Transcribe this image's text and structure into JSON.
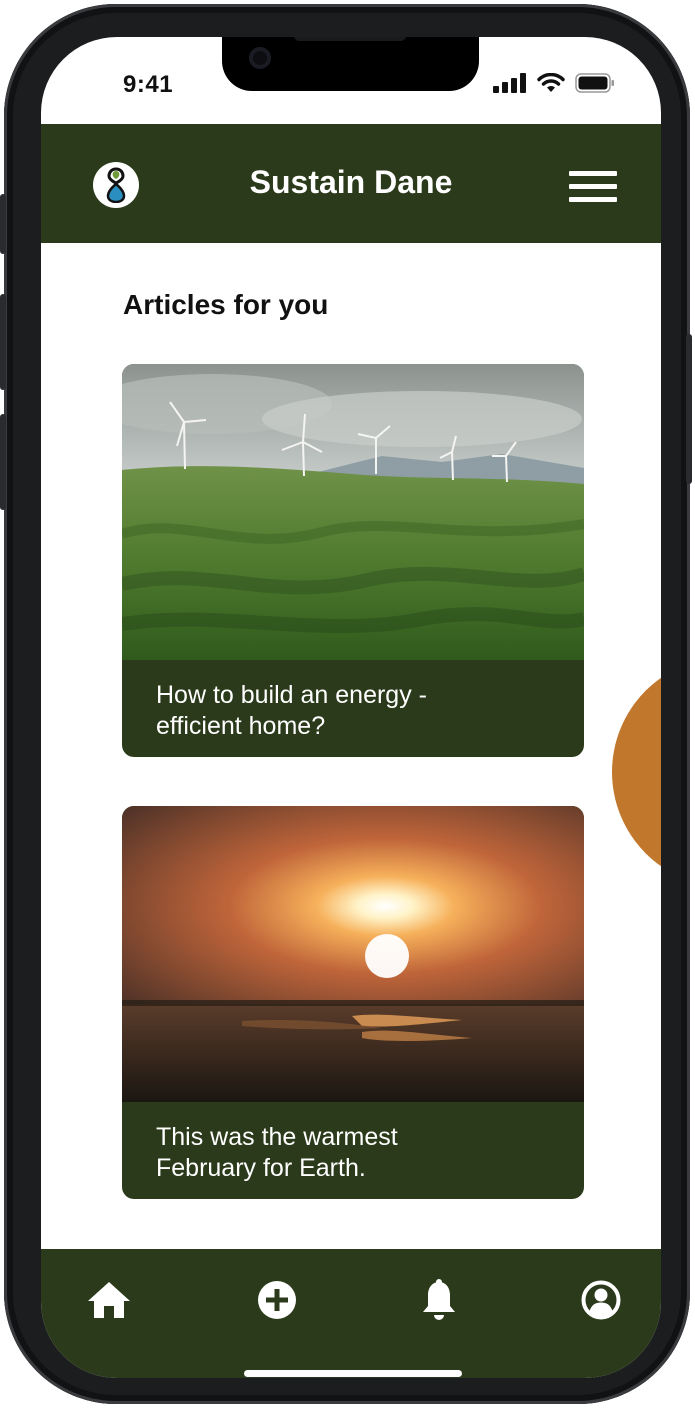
{
  "status_bar": {
    "time": "9:41"
  },
  "header": {
    "app_title": "Sustain Dane"
  },
  "section": {
    "title": "Articles for you"
  },
  "articles": [
    {
      "caption_line1": "How to build an energy -",
      "caption_line2": "efficient home?"
    },
    {
      "caption_line1": "This was the warmest",
      "caption_line2": "February for Earth."
    }
  ],
  "bottom_nav": {
    "items": [
      "home-icon",
      "add-circle-icon",
      "bell-icon",
      "account-circle-icon"
    ]
  },
  "colors": {
    "header_bg": "#2b3a1a",
    "accent_orange": "#c1782d",
    "text_light": "#ffffff"
  }
}
